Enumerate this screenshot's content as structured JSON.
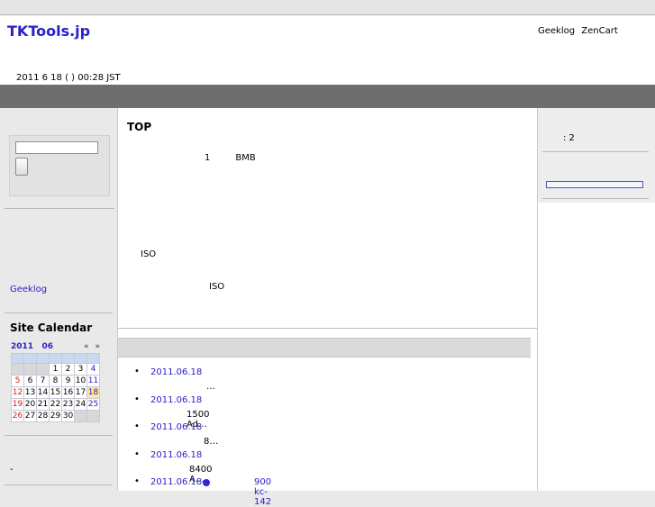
{
  "header": {
    "site_title": "TKTools.jp",
    "links": [
      "Geeklog",
      "ZenCart"
    ],
    "datetime": "2011 6 18 ( ) 00:28 JST"
  },
  "left": {
    "geeklog_link": "Geeklog",
    "calendar": {
      "title": "Site Calendar",
      "year": "2011",
      "month": "06",
      "prev": "«",
      "next": "»",
      "weeks": [
        [
          "",
          "",
          "",
          "1",
          "2",
          "3",
          "4"
        ],
        [
          "5",
          "6",
          "7",
          "8",
          "9",
          "10",
          "11"
        ],
        [
          "12",
          "13",
          "14",
          "15",
          "16",
          "17",
          "18"
        ],
        [
          "19",
          "20",
          "21",
          "22",
          "23",
          "24",
          "25"
        ],
        [
          "26",
          "27",
          "28",
          "29",
          "30",
          "",
          ""
        ]
      ],
      "today": "18"
    },
    "dash_text": "-"
  },
  "main": {
    "title": "TOP",
    "line1": [
      "1",
      "BMB"
    ],
    "line2": "ISO",
    "line3": "ISO",
    "news": [
      {
        "date": "2011.06.18",
        "text": "…",
        "indent": 62
      },
      {
        "date": "2011.06.18",
        "text": "1500 Ad…",
        "indent": 40
      },
      {
        "date": "2011.06.18",
        "text": "8…",
        "indent": 59
      },
      {
        "date": "2011.06.18",
        "text": "8400 A…",
        "indent": 43
      },
      {
        "date": "2011.06.18",
        "extra": "900 kc-142",
        "dot": true
      }
    ]
  },
  "right": {
    "count": ": 2"
  }
}
